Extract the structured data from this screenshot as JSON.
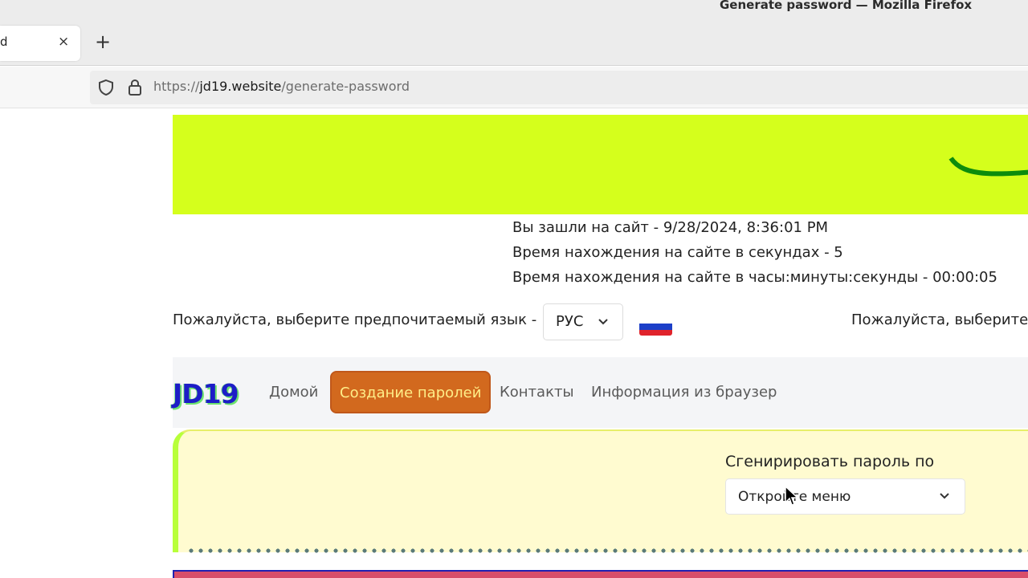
{
  "window": {
    "title": "Generate password — Mozilla Firefox"
  },
  "tabs": [
    {
      "title": "d",
      "close": "×"
    }
  ],
  "newtab": "+",
  "url": {
    "scheme": "https://",
    "host": "jd19.website",
    "path": "/generate-password"
  },
  "visit": {
    "entered": "Вы зашли на сайт - 9/28/2024, 8:36:01 PM",
    "seconds": "Время нахождения на сайте в секундах - 5",
    "hms": "Время нахождения на сайте в часы:минуты:секунды - 00:00:05"
  },
  "language": {
    "prompt": "Пожалуйста, выберите предпочитаемый язык -",
    "selected": "РУС",
    "prompt_repeat": "Пожалуйста, выберите"
  },
  "nav": {
    "brand": "JD19",
    "items": [
      {
        "label": "Домой"
      },
      {
        "label": "Создание паролей"
      },
      {
        "label": "Контакты"
      },
      {
        "label": "Информация из браузер"
      }
    ]
  },
  "generator": {
    "label": "Сгенирировать пароль по",
    "select_value": "Откройте меню"
  },
  "colors": {
    "banner": "#d5ff1c",
    "nav_active": "#d2691e",
    "panel": "#fffbd0"
  }
}
